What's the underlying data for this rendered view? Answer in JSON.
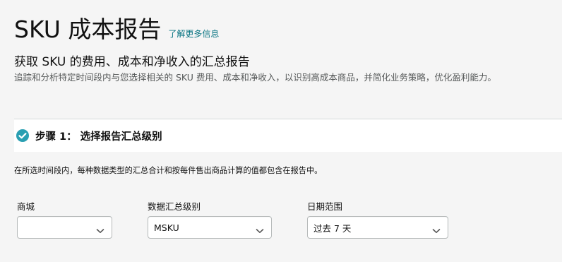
{
  "header": {
    "title": "SKU 成本报告",
    "learn_more": "了解更多信息",
    "subtitle": "获取 SKU 的费用、成本和净收入的汇总报告",
    "description": "追踪和分析特定时间段内与您选择相关的 SKU 费用、成本和净收入，以识别高成本商品，并简化业务策略，优化盈利能力。"
  },
  "step1": {
    "title": "步骤 1： 选择报告汇总级别",
    "status_icon": "check-circle-icon",
    "description": "在所选时间段内，每种数据类型的汇总合计和按每件售出商品计算的值都包含在报告中。",
    "fields": {
      "marketplace": {
        "label": "商城",
        "value": ""
      },
      "aggregation": {
        "label": "数据汇总级别",
        "value": "MSKU"
      },
      "date_range": {
        "label": "日期范围",
        "value": "过去 7 天"
      }
    }
  },
  "colors": {
    "link": "#0a7583",
    "check": "#2a9fb2",
    "background": "#f5f5f5"
  }
}
